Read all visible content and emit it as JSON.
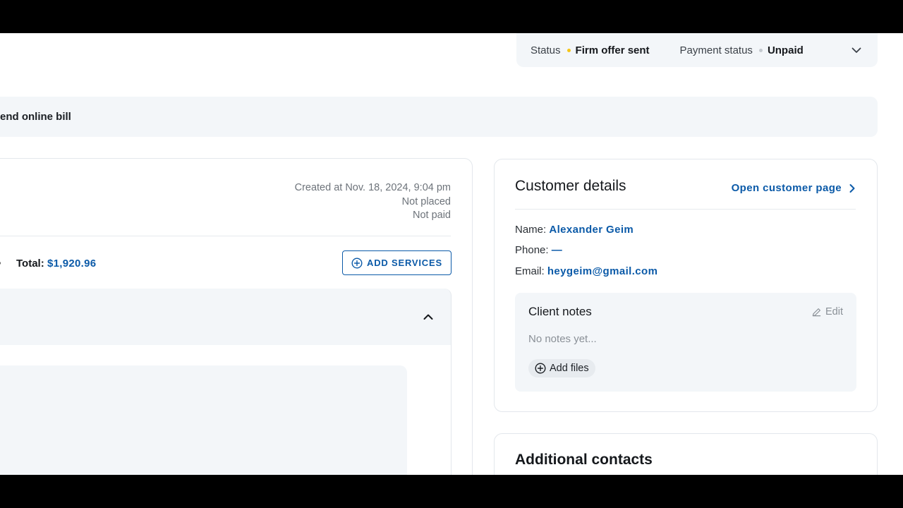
{
  "status_bar": {
    "status_label": "Status",
    "status_value": "Firm offer sent",
    "status_color": "#f5c518",
    "payment_label": "Payment status",
    "payment_value": "Unpaid",
    "payment_color": "#c4c9cf",
    "expand_icon": "chevron-down-icon"
  },
  "banner": {
    "text": "end online bill"
  },
  "order": {
    "created": "Created at Nov. 18, 2024, 9:04 pm",
    "placement": "Not placed",
    "payment": "Not paid",
    "total_label": "Total:",
    "total_value": "$1,920.96",
    "add_services_label": "ADD SERVICES",
    "add_services_icon": "plus-circle-icon",
    "collapse_icon": "chevron-up-icon"
  },
  "customer": {
    "title": "Customer details",
    "open_link": "Open customer page",
    "open_icon": "chevron-right-icon",
    "name_label": "Name:",
    "name_value": "Alexander Geim",
    "phone_label": "Phone:",
    "phone_value": "—",
    "email_label": "Email:",
    "email_value": "heygeim@gmail.com",
    "notes": {
      "title": "Client notes",
      "edit_label": "Edit",
      "edit_icon": "pencil-icon",
      "empty_text": "No notes yet...",
      "add_files_label": "Add files",
      "add_files_icon": "plus-circle-icon"
    }
  },
  "additional_contacts": {
    "title": "Additional contacts"
  },
  "colors": {
    "accent": "#0b5aa8",
    "panel_bg": "#f3f6f9",
    "border": "#e3e7ec"
  }
}
